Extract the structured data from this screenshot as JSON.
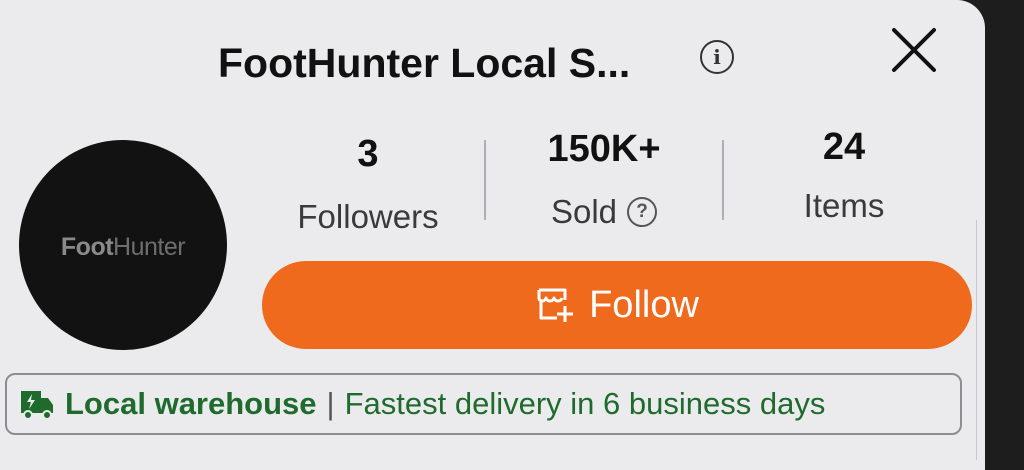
{
  "store": {
    "title": "FootHunter Local S...",
    "logo_text_a": "Foot",
    "logo_text_b": "Hunter"
  },
  "icons": {
    "info": "info-icon",
    "close": "close-icon",
    "help": "question-icon",
    "follow": "store-add-icon",
    "truck": "truck-icon"
  },
  "stats": {
    "followers": {
      "value": "3",
      "label": "Followers"
    },
    "sold": {
      "value": "150K+",
      "label": "Sold"
    },
    "items": {
      "value": "24",
      "label": "Items"
    }
  },
  "follow_button": {
    "label": "Follow"
  },
  "delivery": {
    "highlight": "Local warehouse",
    "separator": "|",
    "text": "Fastest delivery in 6 business days"
  },
  "colors": {
    "accent": "#ef6a1c",
    "green": "#1f6b2e",
    "sheet": "#ebebee"
  }
}
